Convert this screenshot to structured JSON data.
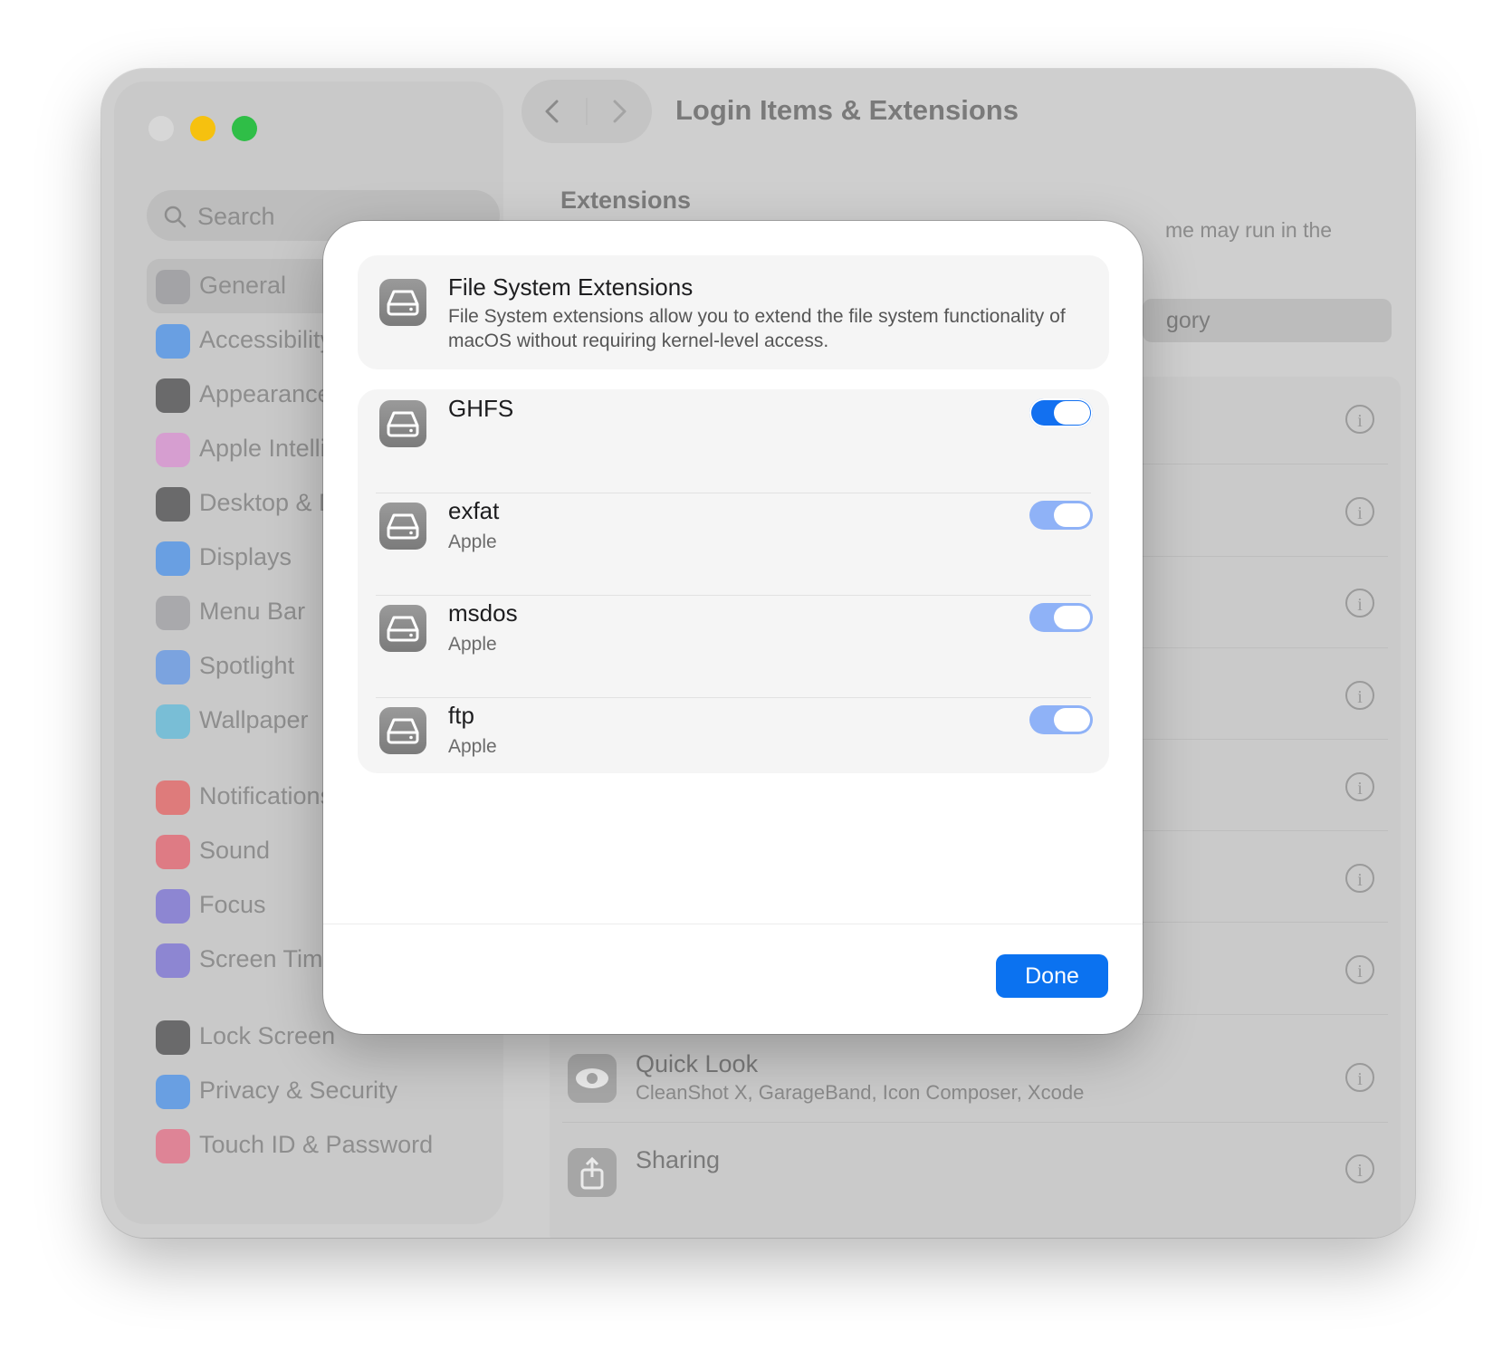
{
  "window": {
    "title": "Login Items & Extensions"
  },
  "search": {
    "placeholder": "Search"
  },
  "sidebar": {
    "items": [
      {
        "label": "General",
        "icon": "gear-icon",
        "color": "#8e8e93",
        "active": true
      },
      {
        "label": "Accessibility",
        "icon": "accessibility-icon",
        "color": "#1a7bf5"
      },
      {
        "label": "Appearance",
        "icon": "appearance-icon",
        "color": "#1c1c1e"
      },
      {
        "label": "Apple Intellig",
        "icon": "apple-intelligence-icon",
        "color": "#e07ad6"
      },
      {
        "label": "Desktop & D",
        "icon": "desktop-dock-icon",
        "color": "#1c1c1e"
      },
      {
        "label": "Displays",
        "icon": "displays-icon",
        "color": "#1a7bf5"
      },
      {
        "label": "Menu Bar",
        "icon": "menu-bar-icon",
        "color": "#8e8e93"
      },
      {
        "label": "Spotlight",
        "icon": "spotlight-icon",
        "color": "#3a84f0"
      },
      {
        "label": "Wallpaper",
        "icon": "wallpaper-icon",
        "color": "#36b4e0"
      },
      {
        "label": "Notifications",
        "icon": "notifications-icon",
        "color": "#ee3b3b"
      },
      {
        "label": "Sound",
        "icon": "sound-icon",
        "color": "#ee3b4b"
      },
      {
        "label": "Focus",
        "icon": "focus-icon",
        "color": "#5b4fd8"
      },
      {
        "label": "Screen Time",
        "icon": "screen-time-icon",
        "color": "#5b4fd8"
      },
      {
        "label": "Lock Screen",
        "icon": "lock-screen-icon",
        "color": "#1c1c1e"
      },
      {
        "label": "Privacy & Security",
        "icon": "privacy-hand-icon",
        "color": "#1a7bf5"
      },
      {
        "label": "Touch ID & Password",
        "icon": "fingerprint-icon",
        "color": "#ee4b6b"
      }
    ]
  },
  "background": {
    "section_title": "Extensions",
    "description_fragment": "me may run in the",
    "select_fragment": "gory",
    "rows": [
      {
        "title": "Quick Look",
        "subtitle": "CleanShot X, GarageBand, Icon Composer, Xcode"
      },
      {
        "title": "Sharing",
        "subtitle": ""
      }
    ]
  },
  "modal": {
    "header": {
      "title": "File System Extensions",
      "description": "File System extensions allow you to extend the file system functionality of macOS without requiring kernel-level access."
    },
    "extensions": [
      {
        "name": "GHFS",
        "vendor": "",
        "enabled": true,
        "focused": true
      },
      {
        "name": "exfat",
        "vendor": "Apple",
        "enabled": true,
        "focused": false
      },
      {
        "name": "msdos",
        "vendor": "Apple",
        "enabled": true,
        "focused": false
      },
      {
        "name": "ftp",
        "vendor": "Apple",
        "enabled": true,
        "focused": false
      }
    ],
    "done_label": "Done"
  },
  "colors": {
    "accent": "#0b72f0",
    "toggle_on_inactive": "#8fb2f7",
    "traffic_minimize": "#f6c10f",
    "traffic_maximize": "#2fbe47"
  }
}
